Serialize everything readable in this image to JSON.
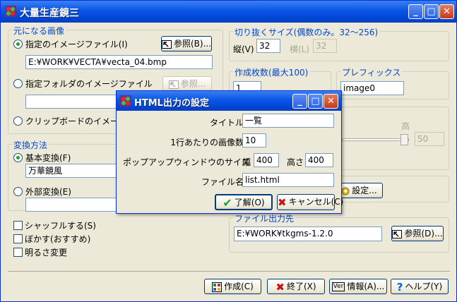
{
  "window": {
    "title": "大量生産鏡三",
    "controls": {
      "minimize": "_",
      "maximize": "□",
      "close": "✕"
    }
  },
  "source": {
    "legend": "元になる画像",
    "file_option": "指定のイメージファイル(I)",
    "file_path": "E:¥WORK¥VECTA¥vecta_04.bmp",
    "browse1": "参照(B)...",
    "folder_option": "指定フォルダのイメージファイル",
    "folder_path": "",
    "browse2": "参照...",
    "clipboard_option": "クリップボードのイメージ"
  },
  "crop": {
    "legend": "切り抜くサイズ(偶数のみ。32〜256)",
    "height_label": "縦(V)",
    "height_value": "32",
    "width_label": "横(L)",
    "width_value": "32"
  },
  "count": {
    "legend": "作成枚数(最大100)",
    "value": "1"
  },
  "prefix": {
    "legend": "プレフィックス",
    "value": "image0"
  },
  "brightness": {
    "high_label": "高",
    "value": "50"
  },
  "settings_button": "設定...",
  "convert": {
    "legend": "変換方法",
    "basic_option": "基本変換(F)",
    "basic_value": "万華鏡風",
    "external_option": "外部変換(E)",
    "external_value": ""
  },
  "options": {
    "shuffle": "シャッフルする(S)",
    "blur": "ぼかす(おすすめ)",
    "brightness": "明るさ変更"
  },
  "output": {
    "legend": "ファイル出力先",
    "path": "E:¥WORK¥tkgms-1.2.0",
    "browse": "参照(D)..."
  },
  "buttons": {
    "create": "作成(C)",
    "exit": "終了(X)",
    "info": "情報(A)...",
    "help": "ヘルプ(Y)"
  },
  "dialog": {
    "title": "HTML出力の設定",
    "title_label": "タイトル",
    "title_value": "一覧",
    "per_row_label": "1行あたりの画像数",
    "per_row_value": "10",
    "popup_label": "ポップアップウィンドウのサイズ",
    "popup_width_label": "幅",
    "popup_width": "400",
    "popup_height_label": "高さ",
    "popup_height": "400",
    "filename_label": "ファイル名",
    "filename_value": "list.html",
    "ok": "了解(O)",
    "cancel": "キャンセル(C)",
    "controls": {
      "minimize": "_",
      "maximize": "□",
      "close": "✕"
    }
  },
  "icons": {
    "app": "kaleidoscope-icon",
    "browse": "browse-arrow-icon",
    "create": "grid-icon",
    "exit": "x-icon",
    "info": "info-icon",
    "help": "question-icon",
    "ok": "checkmark-icon",
    "cancel": "x-icon",
    "settings": "gear-icon"
  },
  "colors": {
    "accent": "#0046d5",
    "check_green": "#21a121",
    "exit_red": "#cc1111",
    "face": "#ece9d8"
  }
}
